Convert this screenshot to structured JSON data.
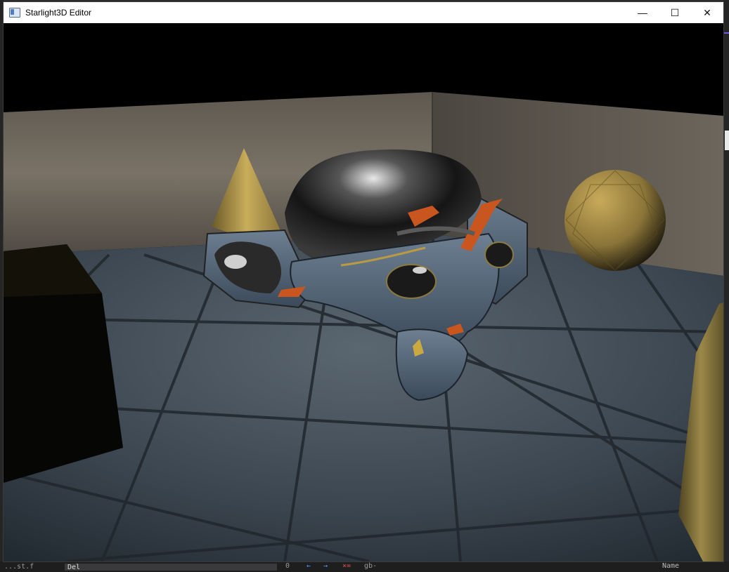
{
  "window": {
    "title": "Starlight3D Editor",
    "controls": {
      "minimize": "—",
      "maximize": "☐",
      "close": "✕"
    }
  },
  "viewport": {
    "scene_objects": [
      "wall-back",
      "tiled-floor",
      "gold-cone",
      "chrome-monkey-head",
      "gold-sphere",
      "black-cube",
      "gold-pillar"
    ],
    "colors": {
      "wall": "#6b645a",
      "floor": "#3f4a54",
      "gold": "#b09650",
      "chrome": "#1a1a1a",
      "accent_orange": "#c8561e"
    }
  },
  "background_editor": {
    "field_value": "Del",
    "left_text": "...st.f",
    "num": "0",
    "arrows": "← →",
    "clear": "×=",
    "gb": "gb-",
    "right_text": "Name"
  }
}
